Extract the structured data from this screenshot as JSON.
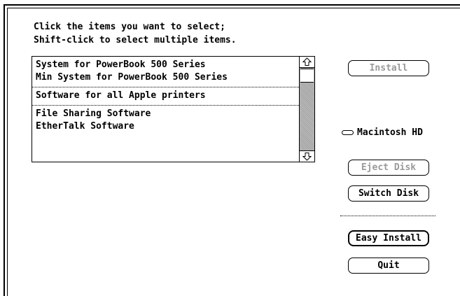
{
  "instructions": {
    "line1": "Click the items you want to select;",
    "line2": "Shift-click to select multiple items."
  },
  "package_list": {
    "groups": [
      {
        "items": [
          "System for PowerBook 500 Series",
          "Min System for PowerBook 500 Series"
        ]
      },
      {
        "items": [
          "Software for all Apple printers"
        ]
      },
      {
        "items": [
          "File Sharing Software",
          "EtherTalk Software"
        ]
      }
    ],
    "scroll_position": 0.0
  },
  "buttons": {
    "install": {
      "label": "Install",
      "enabled": false
    },
    "eject_disk": {
      "label": "Eject Disk",
      "enabled": false
    },
    "switch_disk": {
      "label": "Switch Disk",
      "enabled": true
    },
    "easy_install": {
      "label": "Easy Install",
      "enabled": true
    },
    "quit": {
      "label": "Quit",
      "enabled": true
    }
  },
  "target_disk": {
    "name": "Macintosh HD",
    "icon": "hard-disk-icon"
  }
}
